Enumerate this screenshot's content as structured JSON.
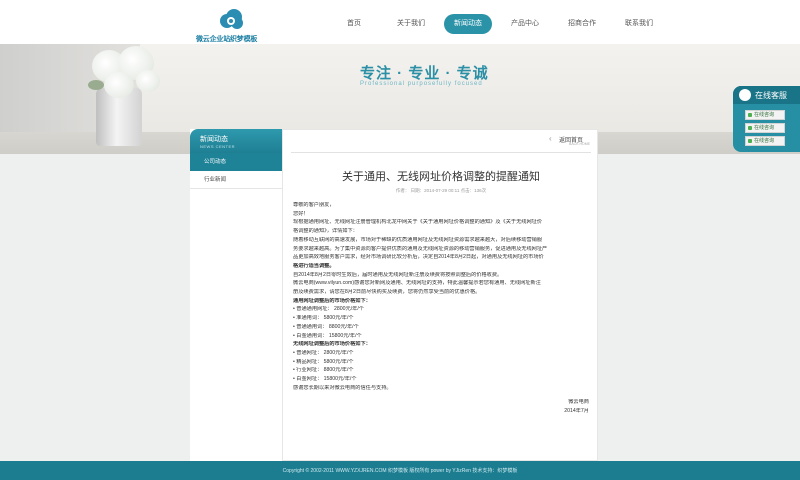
{
  "header": {
    "logo_text": "微云企业站织梦模板",
    "nav": [
      {
        "label": "首页",
        "active": false
      },
      {
        "label": "关于我们",
        "active": false
      },
      {
        "label": "新闻动态",
        "active": true
      },
      {
        "label": "产品中心",
        "active": false
      },
      {
        "label": "招商合作",
        "active": false
      },
      {
        "label": "联系我们",
        "active": false
      }
    ]
  },
  "banner": {
    "slogan": "专注 · 专业 · 专诚",
    "sub": "Professional   purposefully   focused"
  },
  "service": {
    "title": "在线客服",
    "buttons": [
      "在线咨询",
      "在线咨询",
      "在线咨询"
    ]
  },
  "sidebar": {
    "title": "新闻动态",
    "subtitle": "NEWS CENTER",
    "items": [
      {
        "label": "公司动态",
        "active": true
      },
      {
        "label": "行业新闻",
        "active": false
      }
    ]
  },
  "article": {
    "back_label": "返回首页",
    "back_sub": "BACK HOME",
    "title": "关于通用、无线网址价格调整的提醒通知",
    "meta": "作者：   日期：2014-07-29 00:11   点击：136次",
    "lines": [
      {
        "text": "尊敬的客户朋友，",
        "style": "normal"
      },
      {
        "text": "您好！",
        "style": "normal"
      },
      {
        "text": "    现根据通用网址、无线网址注册管理机构北龙中网关于《关于通用网址价格调整的通知》及《关于无线网址价",
        "style": "normal"
      },
      {
        "text": "格调整的通知》，详情如下：",
        "style": "normal"
      },
      {
        "text": "    随着移动互联网的高速发展，市场对于稀缺的优质通用网址及无线网址资源需求越来越大，对后续移动营销服",
        "style": "normal"
      },
      {
        "text": "务要求越来越高。为了集中资源向客户提供优质的通用及无线网址资源的移动营销服务，促进通用及无线网址产",
        "style": "normal"
      },
      {
        "text": "品更加高效地服务客户需求，经对市场调研比较分析后，决定自2014年8月2日起，对通用及无线网址的市场价",
        "style": "normal"
      },
      {
        "text": "格进行适当调整。",
        "style": "bold"
      },
      {
        "text": "    自2014年8月2日零时生效后，届时通用及无线网址新注册及续费将按照调整后的价格收费。",
        "style": "normal"
      },
      {
        "text": "    微云电商(www.vilyun.com)感谢您对新网及通用、无线网址的支持，特此温馨提示若您有通用、无线网址新注",
        "style": "normal"
      },
      {
        "text": "册及续费需求，请您在8月2日前尽快购买及续费，您将仍然享受当前的优惠价格。",
        "style": "normal"
      },
      {
        "text": "通用网址调整后的市场价格如下：",
        "style": "bold"
      },
      {
        "text": "• 普通通用网址：  2800元/年/个",
        "style": "normal"
      },
      {
        "text": "• 准通用词：  5800元/年/个",
        "style": "normal"
      },
      {
        "text": "• 普通通用词：  8800元/年/个",
        "style": "normal"
      },
      {
        "text": "• 白金通用词：  15800元/年/个",
        "style": "normal"
      },
      {
        "text": "无线网址调整后的市场价格如下：",
        "style": "bold"
      },
      {
        "text": "• 普通网址：  2800元/年/个",
        "style": "normal"
      },
      {
        "text": "• 精品网址：  5800元/年/个",
        "style": "normal"
      },
      {
        "text": "• 行业网址：  8800元/年/个",
        "style": "normal"
      },
      {
        "text": "• 白金网址：  15800元/年/个",
        "style": "normal"
      },
      {
        "text": "感谢您长期以来对微云电商的信任与支持。",
        "style": "normal"
      },
      {
        "text": "微云电商",
        "style": "right"
      },
      {
        "text": "2014年7月",
        "style": "right"
      }
    ]
  },
  "footer": {
    "text": "Copyright © 2002-2011 WWW.YZXJREN.COM 织梦模板 版权所有 power by YJizRen 技术支持：织梦模板"
  },
  "colors": {
    "accent": "#2a93a8",
    "footer": "#1d7d90"
  }
}
